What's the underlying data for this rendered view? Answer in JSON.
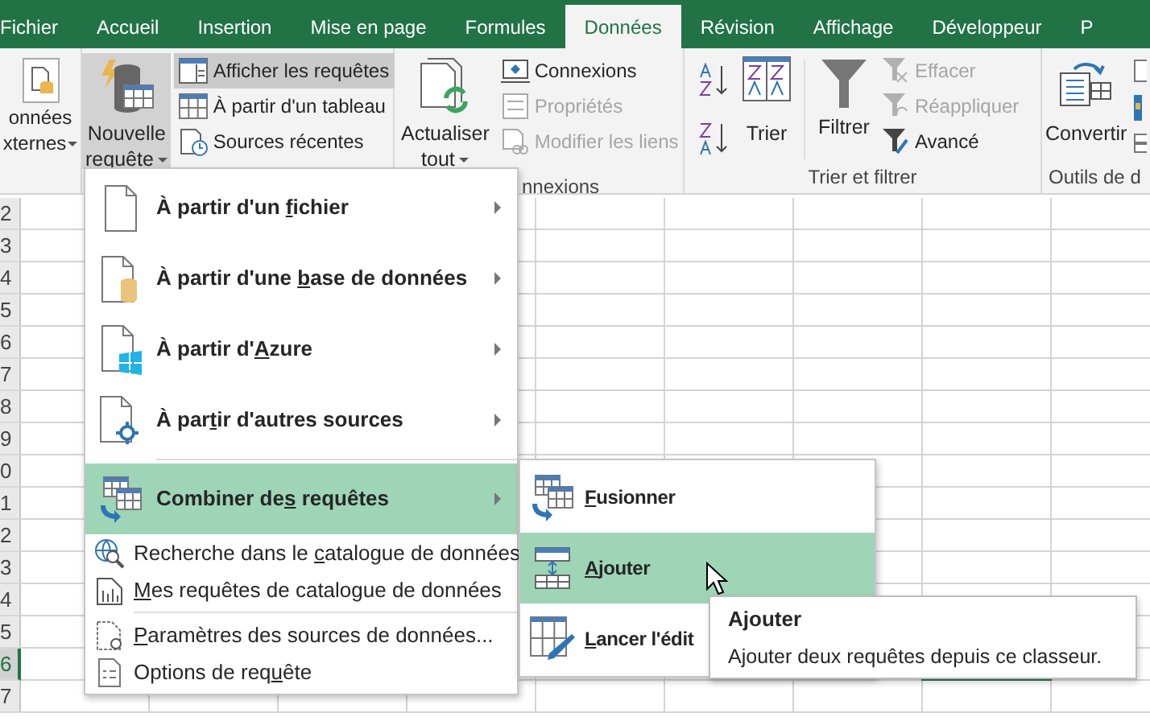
{
  "tabs": [
    {
      "label": "Fichier",
      "selected": false
    },
    {
      "label": "Accueil",
      "selected": false
    },
    {
      "label": "Insertion",
      "selected": false
    },
    {
      "label": "Mise en page",
      "selected": false
    },
    {
      "label": "Formules",
      "selected": false
    },
    {
      "label": "Données",
      "selected": true
    },
    {
      "label": "Révision",
      "selected": false
    },
    {
      "label": "Affichage",
      "selected": false
    },
    {
      "label": "Développeur",
      "selected": false
    },
    {
      "label": "P",
      "selected": false
    }
  ],
  "ribbon": {
    "external_data": {
      "lines": [
        "onnées",
        "xternes"
      ]
    },
    "get_transform": {
      "large": {
        "lines": [
          "Nouvelle",
          "requête"
        ],
        "pressed": true
      },
      "small": [
        {
          "label": "Afficher les requêtes",
          "highlighted": true
        },
        {
          "label": "À partir d'un tableau",
          "highlighted": false
        },
        {
          "label": "Sources récentes",
          "highlighted": false
        }
      ]
    },
    "connections": {
      "large": {
        "lines": [
          "Actualiser",
          "tout"
        ]
      },
      "small": [
        {
          "label": "Connexions",
          "disabled": false
        },
        {
          "label": "Propriétés",
          "disabled": true
        },
        {
          "label": "Modifier les liens",
          "disabled": true
        }
      ],
      "group_label": "nnexions"
    },
    "sort_filter": {
      "sort": "Trier",
      "filter": "Filtrer",
      "small": [
        {
          "label": "Effacer",
          "disabled": true
        },
        {
          "label": "Réappliquer",
          "disabled": true
        },
        {
          "label": "Avancé",
          "disabled": false
        }
      ],
      "group_label": "Trier et filtrer"
    },
    "tools": {
      "convert": "Convertir",
      "group_label": "Outils de d"
    }
  },
  "grid": {
    "rows": [
      {
        "number": "2",
        "selected": false
      },
      {
        "number": "3",
        "selected": false
      },
      {
        "number": "4",
        "selected": false
      },
      {
        "number": "5",
        "selected": false
      },
      {
        "number": "6",
        "selected": false
      },
      {
        "number": "7",
        "selected": false
      },
      {
        "number": "8",
        "selected": false
      },
      {
        "number": "9",
        "selected": false
      },
      {
        "number": "0",
        "selected": false
      },
      {
        "number": "1",
        "selected": false
      },
      {
        "number": "2",
        "selected": false
      },
      {
        "number": "3",
        "selected": false
      },
      {
        "number": "4",
        "selected": false
      },
      {
        "number": "5",
        "selected": false
      },
      {
        "number": "6",
        "selected": true
      },
      {
        "number": "7",
        "selected": false
      }
    ]
  },
  "menu": {
    "items": [
      {
        "kind": "large",
        "label": {
          "before": "À partir d'un ",
          "key": "f",
          "after": "ichier"
        },
        "submenu": true,
        "highlighted": false
      },
      {
        "kind": "large",
        "label": {
          "before": "À partir d'une ",
          "key": "b",
          "after": "ase de données"
        },
        "submenu": true,
        "highlighted": false
      },
      {
        "kind": "large",
        "label": {
          "before": "À partir d'",
          "key": "A",
          "after": "zure"
        },
        "submenu": true,
        "highlighted": false
      },
      {
        "kind": "large",
        "label": {
          "before": "À par",
          "key": "t",
          "after": "ir d'autres sources"
        },
        "submenu": true,
        "highlighted": false
      },
      {
        "kind": "separator"
      },
      {
        "kind": "large",
        "label": {
          "before": "Combiner de",
          "key": "s",
          "after": " requêtes"
        },
        "submenu": true,
        "highlighted": true
      },
      {
        "kind": "small",
        "label": {
          "before": "Recherche dans le ",
          "key": "c",
          "after": "atalogue de données"
        },
        "highlighted": false
      },
      {
        "kind": "small",
        "label": {
          "key": "M",
          "after": "es requêtes de catalogue de données"
        },
        "highlighted": false
      },
      {
        "kind": "separator"
      },
      {
        "kind": "small",
        "label": {
          "key": "P",
          "after": "aramètres des sources de données..."
        },
        "highlighted": false
      },
      {
        "kind": "small",
        "label": {
          "before": "Options de req",
          "key": "u",
          "after": "ête"
        },
        "highlighted": false
      }
    ]
  },
  "submenu": {
    "items": [
      {
        "label": {
          "key": "F",
          "after": "usionner"
        },
        "highlighted": false
      },
      {
        "label": {
          "key": "A",
          "after": "jouter"
        },
        "highlighted": true
      },
      {
        "label": {
          "key": "L",
          "after": "ancer l'édit"
        },
        "highlighted": false
      }
    ]
  },
  "tooltip": {
    "title": "Ajouter",
    "description": "Ajouter deux requêtes depuis ce classeur."
  }
}
